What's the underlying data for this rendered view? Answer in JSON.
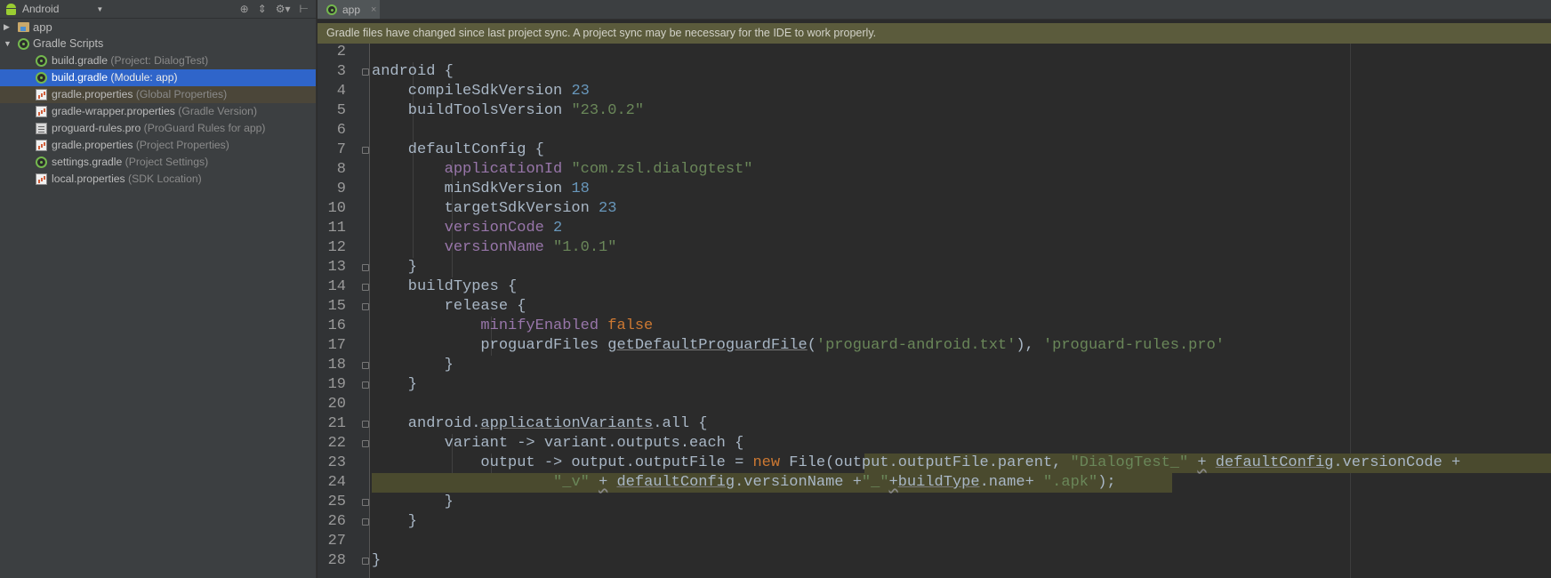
{
  "side_panel": {
    "view_label": "Android",
    "toolbar_icons": [
      "target-icon",
      "collapse-icon",
      "gear-icon",
      "hide-icon"
    ],
    "tree": [
      {
        "label": "app",
        "hint": "",
        "icon": "folder-icon",
        "level": 0,
        "arrow": "▶",
        "state": "normal"
      },
      {
        "label": "Gradle Scripts",
        "hint": "",
        "icon": "gradle-icon",
        "level": 0,
        "arrow": "▼",
        "state": "normal"
      },
      {
        "label": "build.gradle",
        "hint": "(Project: DialogTest)",
        "icon": "gradle-icon",
        "level": 1,
        "arrow": "",
        "state": "normal"
      },
      {
        "label": "build.gradle",
        "hint": "(Module: app)",
        "icon": "gradle-icon",
        "level": 1,
        "arrow": "",
        "state": "selected"
      },
      {
        "label": "gradle.properties",
        "hint": "(Global Properties)",
        "icon": "properties-icon",
        "level": 1,
        "arrow": "",
        "state": "highlight"
      },
      {
        "label": "gradle-wrapper.properties",
        "hint": "(Gradle Version)",
        "icon": "properties-icon",
        "level": 1,
        "arrow": "",
        "state": "normal"
      },
      {
        "label": "proguard-rules.pro",
        "hint": "(ProGuard Rules for app)",
        "icon": "proguard-icon",
        "level": 1,
        "arrow": "",
        "state": "normal"
      },
      {
        "label": "gradle.properties",
        "hint": "(Project Properties)",
        "icon": "properties-icon",
        "level": 1,
        "arrow": "",
        "state": "normal"
      },
      {
        "label": "settings.gradle",
        "hint": "(Project Settings)",
        "icon": "gradle-icon",
        "level": 1,
        "arrow": "",
        "state": "normal"
      },
      {
        "label": "local.properties",
        "hint": "(SDK Location)",
        "icon": "properties-icon",
        "level": 1,
        "arrow": "",
        "state": "normal"
      }
    ]
  },
  "editor": {
    "tab": {
      "label": "app",
      "close": "×"
    },
    "banner": "Gradle files have changed since last project sync. A project sync may be necessary for the IDE to work properly.",
    "lines": [
      {
        "n": "2",
        "fold": false,
        "tokens": []
      },
      {
        "n": "3",
        "fold": true,
        "tokens": [
          [
            "id",
            "android {"
          ]
        ]
      },
      {
        "n": "4",
        "fold": false,
        "tokens": [
          [
            "id",
            "    compileSdkVersion "
          ],
          [
            "num",
            "23"
          ]
        ]
      },
      {
        "n": "5",
        "fold": false,
        "tokens": [
          [
            "id",
            "    buildToolsVersion "
          ],
          [
            "str",
            "\"23.0.2\""
          ]
        ]
      },
      {
        "n": "6",
        "fold": false,
        "tokens": []
      },
      {
        "n": "7",
        "fold": true,
        "tokens": [
          [
            "id",
            "    defaultConfig {"
          ]
        ]
      },
      {
        "n": "8",
        "fold": false,
        "tokens": [
          [
            "id",
            "        "
          ],
          [
            "prop",
            "applicationId"
          ],
          [
            "id",
            " "
          ],
          [
            "str",
            "\"com.zsl.dialogtest\""
          ]
        ]
      },
      {
        "n": "9",
        "fold": false,
        "tokens": [
          [
            "id",
            "        minSdkVersion "
          ],
          [
            "num",
            "18"
          ]
        ]
      },
      {
        "n": "10",
        "fold": false,
        "tokens": [
          [
            "id",
            "        targetSdkVersion "
          ],
          [
            "num",
            "23"
          ]
        ]
      },
      {
        "n": "11",
        "fold": false,
        "tokens": [
          [
            "id",
            "        "
          ],
          [
            "prop",
            "versionCode"
          ],
          [
            "id",
            " "
          ],
          [
            "num",
            "2"
          ]
        ]
      },
      {
        "n": "12",
        "fold": false,
        "tokens": [
          [
            "id",
            "        "
          ],
          [
            "prop",
            "versionName"
          ],
          [
            "id",
            " "
          ],
          [
            "str",
            "\"1.0.1\""
          ]
        ]
      },
      {
        "n": "13",
        "fold": true,
        "tokens": [
          [
            "id",
            "    }"
          ]
        ]
      },
      {
        "n": "14",
        "fold": true,
        "tokens": [
          [
            "id",
            "    buildTypes {"
          ]
        ]
      },
      {
        "n": "15",
        "fold": true,
        "tokens": [
          [
            "id",
            "        release {"
          ]
        ]
      },
      {
        "n": "16",
        "fold": false,
        "tokens": [
          [
            "id",
            "            "
          ],
          [
            "prop",
            "minifyEnabled"
          ],
          [
            "id",
            " "
          ],
          [
            "kw",
            "false"
          ]
        ]
      },
      {
        "n": "17",
        "fold": false,
        "tokens": [
          [
            "id",
            "            proguardFiles "
          ],
          [
            "u",
            "getDefaultProguardFile"
          ],
          [
            "id",
            "("
          ],
          [
            "str",
            "'proguard-android.txt'"
          ],
          [
            "id",
            "), "
          ],
          [
            "str",
            "'proguard-rules.pro'"
          ]
        ]
      },
      {
        "n": "18",
        "fold": true,
        "tokens": [
          [
            "id",
            "        }"
          ]
        ]
      },
      {
        "n": "19",
        "fold": true,
        "tokens": [
          [
            "id",
            "    }"
          ]
        ]
      },
      {
        "n": "20",
        "fold": false,
        "tokens": []
      },
      {
        "n": "21",
        "fold": true,
        "tokens": [
          [
            "id",
            "    android."
          ],
          [
            "u",
            "applicationVariants"
          ],
          [
            "id",
            ".all {"
          ]
        ]
      },
      {
        "n": "22",
        "fold": true,
        "tokens": [
          [
            "id",
            "        variant -> variant.outputs.each {"
          ]
        ]
      },
      {
        "n": "23",
        "fold": false,
        "tokens": [
          [
            "id",
            "            output -> output.outputFile = "
          ],
          [
            "kw",
            "new"
          ],
          [
            "id",
            " File(output.outputFile.parent, "
          ],
          [
            "str",
            "\"DialogTest_\""
          ],
          [
            "id",
            " "
          ],
          [
            "wu",
            "+"
          ],
          [
            "id",
            " "
          ],
          [
            "u",
            "defaultConfig"
          ],
          [
            "id",
            ".versionCode +"
          ]
        ]
      },
      {
        "n": "24",
        "fold": false,
        "tokens": [
          [
            "id",
            "                    "
          ],
          [
            "str",
            "\"_v\""
          ],
          [
            "id",
            " "
          ],
          [
            "wu",
            "+"
          ],
          [
            "id",
            " "
          ],
          [
            "u",
            "defaultConfig"
          ],
          [
            "id",
            ".versionName +"
          ],
          [
            "str",
            "\"_\""
          ],
          [
            "wu",
            "+"
          ],
          [
            "u",
            "buildType"
          ],
          [
            "id",
            ".name+ "
          ],
          [
            "str",
            "\".apk\""
          ],
          [
            "id",
            ");"
          ]
        ]
      },
      {
        "n": "25",
        "fold": true,
        "tokens": [
          [
            "id",
            "        }"
          ]
        ]
      },
      {
        "n": "26",
        "fold": true,
        "tokens": [
          [
            "id",
            "    }"
          ]
        ]
      },
      {
        "n": "27",
        "fold": false,
        "tokens": []
      },
      {
        "n": "28",
        "fold": true,
        "tokens": [
          [
            "id",
            "}"
          ]
        ]
      }
    ]
  }
}
